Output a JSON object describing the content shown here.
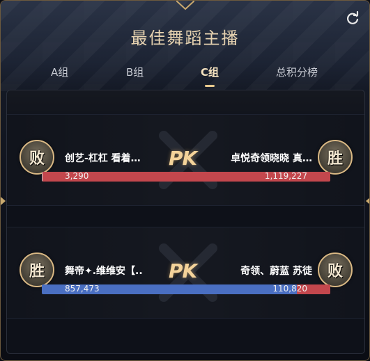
{
  "title": "最佳舞蹈主播",
  "refresh_icon": "refresh-icon",
  "tabs": [
    {
      "label": "A组",
      "active": false
    },
    {
      "label": "B组",
      "active": false
    },
    {
      "label": "C组",
      "active": true
    },
    {
      "label": "总积分榜",
      "active": false
    }
  ],
  "matches": [
    {
      "left": {
        "name": "创艺-杠杠 看着…",
        "score": "3,290",
        "result": "败"
      },
      "right": {
        "name": "卓悦奇领晓晓 真…",
        "score": "1,119,227",
        "result": "胜"
      },
      "vs_label": "PK",
      "left_share": 0.003,
      "left_color": "#c9c9c9",
      "right_color": "#c3474d"
    },
    {
      "left": {
        "name": "舞帝✦.维维安【..",
        "score": "857,473",
        "result": "胜"
      },
      "right": {
        "name": "奇领、蔚蓝 苏徒",
        "score": "110,820",
        "result": "败"
      },
      "vs_label": "PK",
      "left_share": 0.885,
      "left_color": "#4a6fc2",
      "right_color": "#c3474d"
    }
  ],
  "colors": {
    "accent_gold": "#e8c98e",
    "bar_red": "#c3474d",
    "bar_blue": "#4a6fc2"
  }
}
